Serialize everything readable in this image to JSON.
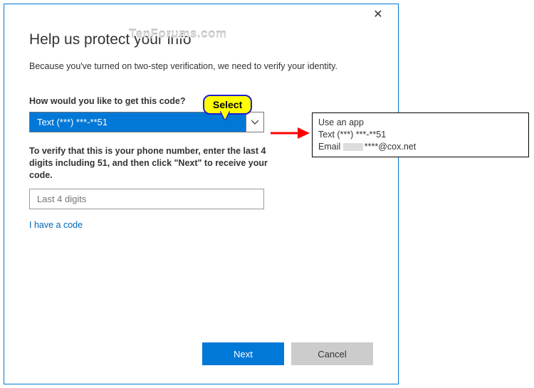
{
  "watermark": "TenForums.com",
  "dialog": {
    "title": "Help us protect your info",
    "subtitle": "Because you've turned on two-step verification, we need to verify your identity.",
    "question_label": "How would you like to get this code?",
    "selected_option": "Text (***) ***-**51",
    "verify_text": "To verify that this is your phone number, enter the last 4 digits including 51, and then click \"Next\" to receive your code.",
    "digits_placeholder": "Last 4 digits",
    "have_code": "I have a code",
    "next_label": "Next",
    "cancel_label": "Cancel"
  },
  "callout": "Select",
  "options": {
    "line1": "Use an app",
    "line2": "Text (***) ***-**51",
    "line3_prefix": "Email",
    "line3_suffix": "****@cox.net"
  }
}
